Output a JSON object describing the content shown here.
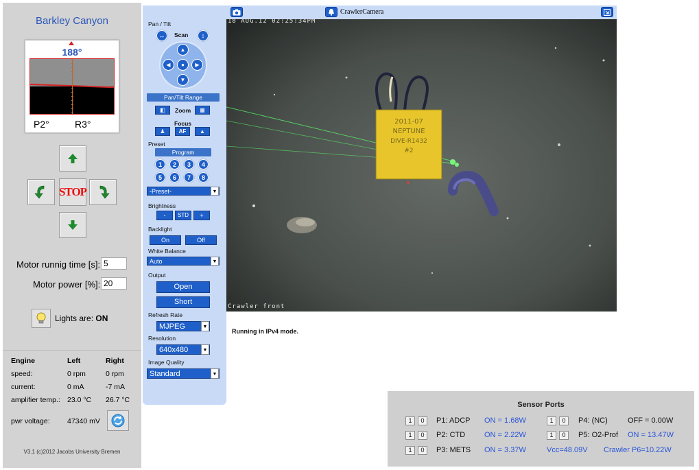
{
  "site": {
    "title": "Barkley Canyon"
  },
  "compass": {
    "heading": "188°",
    "pitch": "P2°",
    "roll": "R3°"
  },
  "drive": {
    "stop_label": "STOP"
  },
  "motor": {
    "time_label": "Motor runnig time [s]:",
    "time_value": "5",
    "power_label": "Motor power [%]:",
    "power_value": "20"
  },
  "lights": {
    "label": "Lights are:",
    "state": "ON"
  },
  "engine": {
    "headers": [
      "Engine",
      "Left",
      "Right"
    ],
    "rows": [
      [
        "speed:",
        "0 rpm",
        "0 rpm"
      ],
      [
        "current:",
        "0 mA",
        "-7 mA"
      ],
      [
        "amplifier temp.:",
        "23.0 °C",
        "26.7 °C"
      ]
    ],
    "pwr_label": "pwr voltage:",
    "pwr_value": "47340 mV"
  },
  "version": "V3.1 (c)2012 Jacobs University Bremen",
  "control": {
    "pan_tilt": "Pan / Tilt",
    "scan": "Scan",
    "pan_tilt_range": "Pan/Tilt Range",
    "zoom": "Zoom",
    "focus": "Focus",
    "focus_af": "AF",
    "preset": "Preset",
    "program": "Program",
    "preset_numbers": [
      "1",
      "2",
      "3",
      "4",
      "5",
      "6",
      "7",
      "8"
    ],
    "preset_select": "-Preset-",
    "brightness": "Brightness",
    "brightness_minus": "-",
    "brightness_std": "STD",
    "brightness_plus": "+",
    "backlight": "Backlight",
    "backlight_on": "On",
    "backlight_off": "Off",
    "white_balance": "White Balance",
    "white_balance_value": "Auto",
    "output": "Output",
    "output_open": "Open",
    "output_short": "Short",
    "refresh_rate": "Refresh Rate",
    "refresh_rate_value": "MJPEG",
    "resolution": "Resolution",
    "resolution_value": "640x480",
    "image_quality": "Image Quality",
    "image_quality_value": "Standard"
  },
  "camera": {
    "title": "CrawlerCamera",
    "timestamp": "18 AUG.12 02:25:34PM",
    "caption": "Crawler front",
    "sign_lines": [
      "2011-07",
      "NEPTUNE",
      "DIVE-R1432",
      "#2"
    ],
    "mode": "Running in IPv4 mode."
  },
  "sensors": {
    "title": "Sensor Ports",
    "btn_on": "1",
    "btn_off": "0",
    "ports": [
      {
        "name": "P1: ADCP",
        "value": "ON = 1.68W"
      },
      {
        "name": "P2: CTD",
        "value": "ON = 2.22W"
      },
      {
        "name": "P3: METS",
        "value": "ON = 3.37W"
      },
      {
        "name": "P4: (NC)",
        "value": "OFF = 0.00W"
      },
      {
        "name": "P5: O2-Prof",
        "value": "ON = 13.47W"
      }
    ],
    "vcc": "Vcc=48.09V",
    "crawler_p6": "Crawler P6=10.22W"
  }
}
